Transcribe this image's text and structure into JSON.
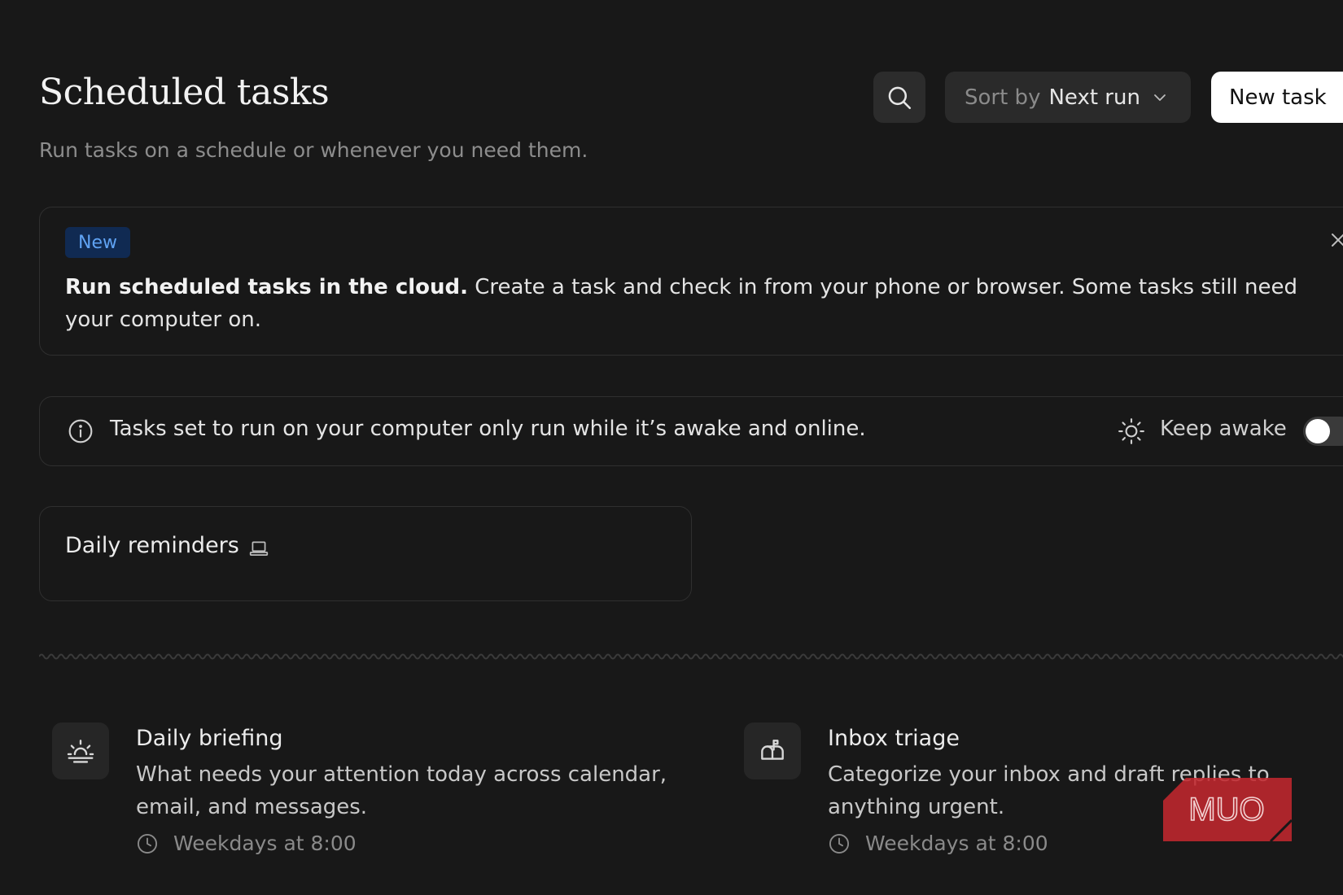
{
  "header": {
    "title": "Scheduled tasks",
    "subtitle": "Run tasks on a schedule or whenever you need them.",
    "sort_prefix": "Sort by",
    "sort_value": "Next run",
    "new_task_label": "New task"
  },
  "banner": {
    "badge": "New",
    "bold_text": "Run scheduled tasks in the cloud.",
    "body_text": " Create a task and check in from your phone or browser. Some tasks still need your computer on."
  },
  "info_bar": {
    "text": "Tasks set to run on your computer only run while it’s awake and online.",
    "keep_awake_label": "Keep awake",
    "keep_awake_on": false
  },
  "tasks": [
    {
      "name": "Daily reminders",
      "location_icon": "laptop-icon"
    }
  ],
  "templates": [
    {
      "icon": "sunrise-icon",
      "title": "Daily briefing",
      "description": "What needs your attention today across calendar, email, and messages.",
      "schedule": "Weekdays at 8:00"
    },
    {
      "icon": "mailbox-icon",
      "title": "Inbox triage",
      "description": "Categorize your inbox and draft replies to anything urgent.",
      "schedule": "Weekdays at 8:00"
    }
  ],
  "watermark": "MUO",
  "colors": {
    "background": "#181818",
    "badge_bg": "#102a52",
    "badge_text": "#5fa2f2",
    "watermark": "#c0272d"
  }
}
